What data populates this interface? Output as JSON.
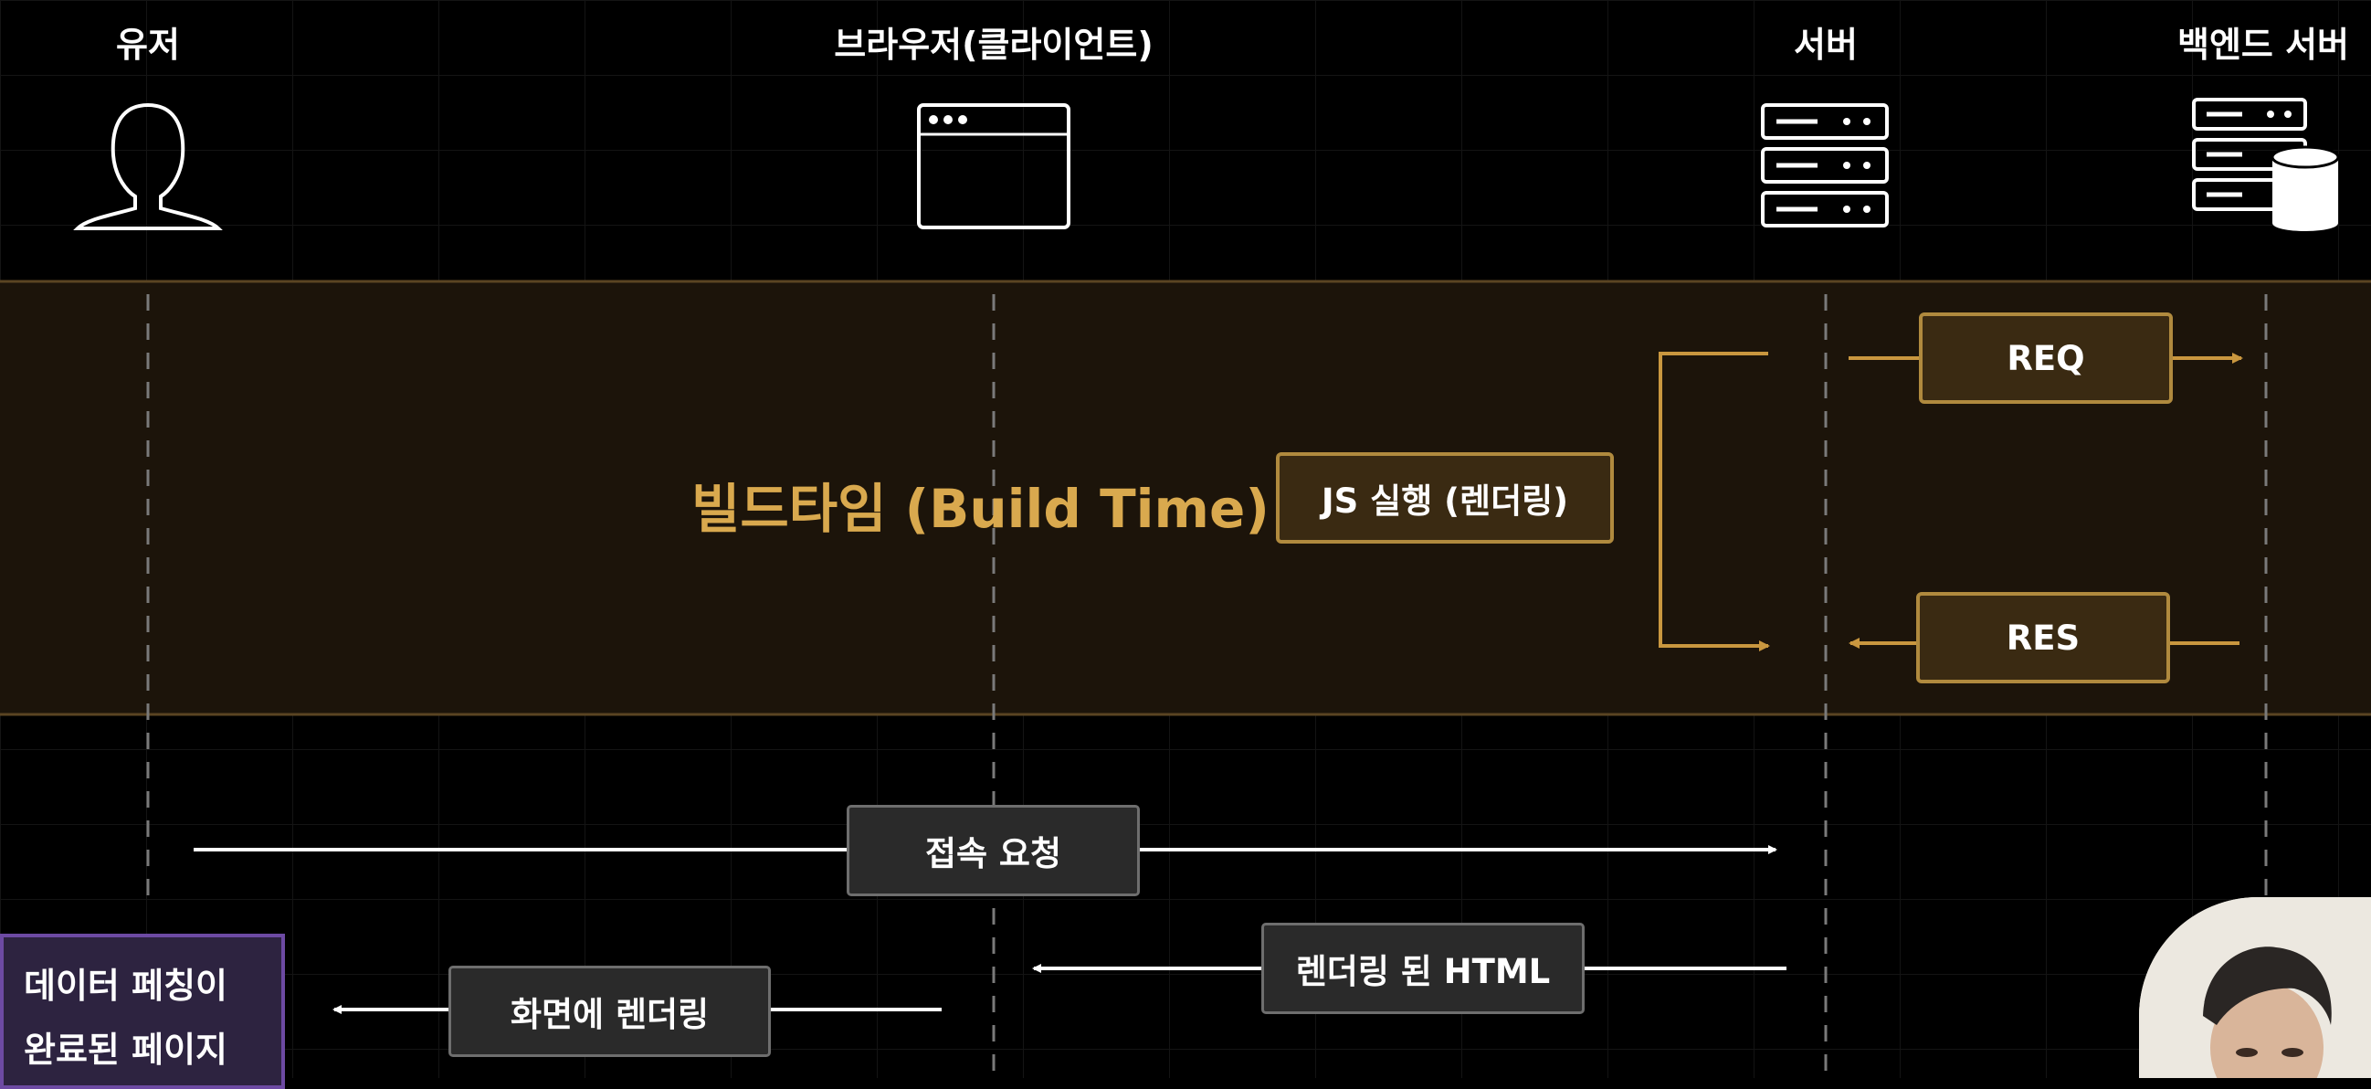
{
  "actors": {
    "user": "유저",
    "browser": "브라우저(클라이언트)",
    "server": "서버",
    "backend": "백엔드 서버"
  },
  "icons": {
    "user": "user-silhouette-icon",
    "browser": "browser-window-icon",
    "server": "server-rack-icon",
    "backend": "server-database-icon"
  },
  "build_phase": {
    "title": "빌드타임 (Build Time)",
    "js_box": "JS 실행 (렌더링)",
    "req_box": "REQ",
    "res_box": "RES"
  },
  "runtime": {
    "connect_request": "접속 요청",
    "rendered_html": "렌더링 된 HTML",
    "render_to_screen": "화면에 렌더링"
  },
  "note": {
    "line1": "데이터 페칭이",
    "line2": "완료된 페이지"
  },
  "colors": {
    "gold": "#d9a94e",
    "gold_border": "#b08a3e",
    "band_fill": "#1c140a",
    "purple_border": "#6d4aa3"
  }
}
